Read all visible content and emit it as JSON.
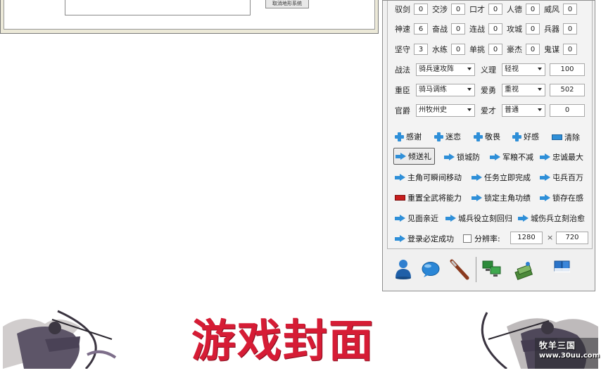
{
  "left_dialog": {
    "button_label": "取消地形系统"
  },
  "stats": {
    "row1": [
      {
        "label": "驭剑",
        "value": "0"
      },
      {
        "label": "交涉",
        "value": "0"
      },
      {
        "label": "口才",
        "value": "0"
      },
      {
        "label": "人德",
        "value": "0"
      },
      {
        "label": "威风",
        "value": "0"
      }
    ],
    "row2": [
      {
        "label": "神速",
        "value": "6"
      },
      {
        "label": "奋战",
        "value": "0"
      },
      {
        "label": "连战",
        "value": "0"
      },
      {
        "label": "攻城",
        "value": "0"
      },
      {
        "label": "兵器",
        "value": "0"
      }
    ],
    "row3": [
      {
        "label": "坚守",
        "value": "3"
      },
      {
        "label": "水练",
        "value": "0"
      },
      {
        "label": "单挑",
        "value": "0"
      },
      {
        "label": "豪杰",
        "value": "0"
      },
      {
        "label": "鬼谋",
        "value": "0"
      }
    ]
  },
  "combos": {
    "tactic": {
      "label": "战法",
      "value": "骑兵速攻阵"
    },
    "justice": {
      "label": "义理",
      "value": "轻视",
      "number": "100"
    },
    "minister": {
      "label": "重臣",
      "value": "骑马调练"
    },
    "courage": {
      "label": "爱勇",
      "value": "重视",
      "number": "502"
    },
    "rank": {
      "label": "官爵",
      "value": "州牧州史"
    },
    "talent": {
      "label": "爱才",
      "value": "普通",
      "number": "0"
    }
  },
  "actions": {
    "thanks": "感谢",
    "obsess": "迷恋",
    "fear": "敬畏",
    "favor": "好感",
    "clear": "清除",
    "gift": "倾送礼",
    "lock_city": "锁城防",
    "no_decrease": "军粮不减",
    "max_loyalty": "忠诚最大",
    "teleport": "主角可瞬间移动",
    "task_done": "任务立即完成",
    "million": "屯兵百万",
    "reset": "重置全武将能力",
    "lock_merit": "锁定主角功绩",
    "lock_presence": "锁存在感",
    "meet_close": "见面亲近",
    "city_return": "城兵役立刻回归",
    "city_heal": "城伤兵立刻治愈",
    "login_success": "登录必定成功"
  },
  "resolution": {
    "label": "分辨率:",
    "width": "1280",
    "times": "×",
    "height": "720"
  },
  "toolbar": [
    "user-icon",
    "chat-bubble-icon",
    "sword-icon",
    "network-icon",
    "money-icon",
    "book-icon"
  ],
  "banner": {
    "title": "游戏封面",
    "watermark_brand": "牧羊三国",
    "watermark_url": "www.30uu.com"
  },
  "colors": {
    "accent_blue": "#2e8fd8",
    "title_red": "#d61c35"
  }
}
